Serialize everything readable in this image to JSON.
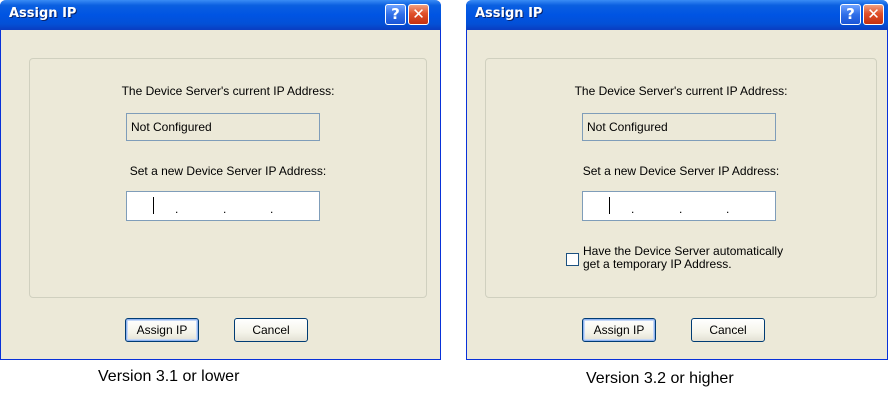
{
  "left_dialog": {
    "title": "Assign IP",
    "help_glyph": "?",
    "close_glyph": "✕",
    "current_ip_label": "The Device Server's current IP Address:",
    "current_ip_value": "Not Configured",
    "new_ip_label": "Set a new Device Server IP Address:",
    "ip_separator": ".",
    "assign_button": "Assign IP",
    "cancel_button": "Cancel"
  },
  "right_dialog": {
    "title": "Assign IP",
    "help_glyph": "?",
    "close_glyph": "✕",
    "current_ip_label": "The Device Server's current IP Address:",
    "current_ip_value": "Not Configured",
    "new_ip_label": "Set a new Device Server IP Address:",
    "ip_separator": ".",
    "checkbox_line1": "Have the Device Server automatically",
    "checkbox_line2": "get a temporary IP Address.",
    "checkbox_checked": false,
    "assign_button": "Assign IP",
    "cancel_button": "Cancel"
  },
  "captions": {
    "left": "Version 3.1 or lower",
    "right": "Version 3.2 or higher"
  },
  "colors": {
    "titlebar": "#0054e3",
    "dialog_bg": "#ece9d8",
    "close_button": "#e0502a"
  }
}
